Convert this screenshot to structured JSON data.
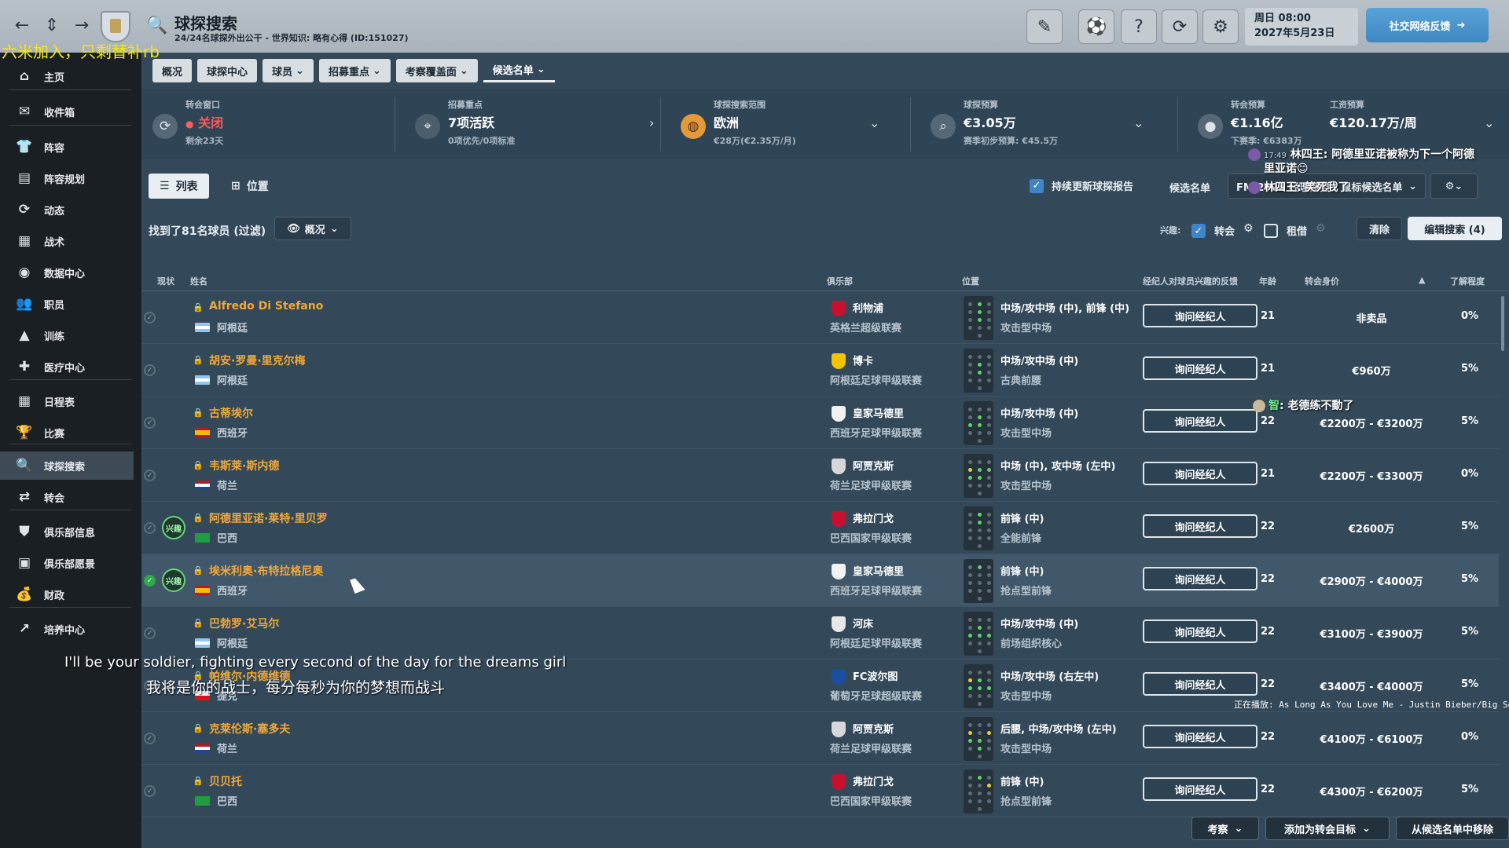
{
  "overlay": {
    "top_banner": "六米加入，只剩替补rb",
    "subtitle_en": "I'll be your soldier, fighting every second of the day for the dreams girl",
    "subtitle_cn": "我将是你的战士，每分每秒为你的梦想而战斗",
    "now_playing": "正在播放: As Long As You Love Me - Justin Bieber/Big Sean",
    "chat": [
      {
        "time": "17:49",
        "user": "林四王",
        "text": "阿德里亚诺被称为下一个阿德"
      },
      {
        "user": "",
        "text": "里亚诺😊"
      },
      {
        "time": "",
        "user": "林四王",
        "text": "笑死我了"
      },
      {
        "user": "智",
        "text": "老德练不動了"
      }
    ]
  },
  "topbar": {
    "title": "球探搜索",
    "subtitle": "24/24名球探外出公干 - 世界知识: 略有心得 (ID:151027)",
    "date_line1": "周日 08:00",
    "date_line2": "2027年5月23日",
    "feedback_label": "社交网络反馈",
    "icons": [
      "back-arrow-icon",
      "up-down-icon",
      "forward-arrow-icon",
      "search-icon",
      "pencil-icon",
      "ball-icon",
      "help-icon",
      "refresh-icon",
      "gear-icon"
    ]
  },
  "sidebar": {
    "items": [
      {
        "label": "主页",
        "icon": "home-icon",
        "glyph": "⌂"
      },
      {
        "label": "收件箱",
        "icon": "inbox-icon",
        "glyph": "✉"
      },
      {
        "label": "阵容",
        "icon": "shirt-icon",
        "glyph": "👕"
      },
      {
        "label": "阵容规划",
        "icon": "squad-planner-icon",
        "glyph": "▤"
      },
      {
        "label": "动态",
        "icon": "dynamics-icon",
        "glyph": "⟳"
      },
      {
        "label": "战术",
        "icon": "tactics-icon",
        "glyph": "▦"
      },
      {
        "label": "数据中心",
        "icon": "data-hub-icon",
        "glyph": "◉"
      },
      {
        "label": "职员",
        "icon": "staff-icon",
        "glyph": "👥"
      },
      {
        "label": "训练",
        "icon": "training-icon",
        "glyph": "▲"
      },
      {
        "label": "医疗中心",
        "icon": "medical-icon",
        "glyph": "✚"
      },
      {
        "label": "日程表",
        "icon": "calendar-icon",
        "glyph": "▦"
      },
      {
        "label": "比赛",
        "icon": "trophy-icon",
        "glyph": "🏆"
      },
      {
        "label": "球探搜索",
        "icon": "search-icon",
        "glyph": "🔍"
      },
      {
        "label": "转会",
        "icon": "transfer-icon",
        "glyph": "⇄"
      },
      {
        "label": "俱乐部信息",
        "icon": "shield-icon",
        "glyph": "⛊"
      },
      {
        "label": "俱乐部愿景",
        "icon": "vision-icon",
        "glyph": "▣"
      },
      {
        "label": "财政",
        "icon": "finance-icon",
        "glyph": "💰"
      },
      {
        "label": "培养中心",
        "icon": "development-icon",
        "glyph": "↗"
      }
    ]
  },
  "tabs": [
    "概况",
    "球探中心",
    "球员",
    "招募重点",
    "考察覆盖面",
    "候选名单"
  ],
  "info": {
    "window": {
      "label": "转会窗口",
      "value": "关闭",
      "sub": "剩余23天"
    },
    "focus": {
      "label": "招募重点",
      "value": "7项活跃",
      "sub": "0项优先/0项标准"
    },
    "range": {
      "label": "球探搜索范围",
      "value": "欧洲",
      "sub": "€28万(€2.35万/月)"
    },
    "budget": {
      "label": "球探预算",
      "value": "€3.05万",
      "sub": "赛季初步预算: €45.5万"
    },
    "transfer": {
      "label": "转会预算",
      "value": "€1.16亿",
      "sub": "下赛季: €6383万"
    },
    "wage": {
      "label": "工资预算",
      "value": "€120.17万/周"
    }
  },
  "toolbar": {
    "list_label": "列表",
    "position_label": "位置",
    "keep_updated_label": "持续更新球探报告",
    "shortlist_label": "候选名单",
    "shortlist_value": "FM 2024 经理商务 - 鼠标候选名单..."
  },
  "found": {
    "text": "找到了81名球员 (过滤)",
    "view_label": "概况",
    "interest_label": "兴趣:",
    "transfer_label": "转会",
    "loan_label": "租借",
    "clear_label": "清除",
    "edit_label": "编辑搜索 (4)"
  },
  "columns": {
    "status": "现状",
    "name": "姓名",
    "club": "俱乐部",
    "position": "位置",
    "agent": "经纪人对球员兴趣的反馈",
    "age": "年龄",
    "value": "转会身价",
    "knowledge": "了解程度"
  },
  "players": [
    {
      "name": "Alfredo Di Stefano",
      "nation": "阿根廷",
      "club": "利物浦",
      "league": "英格兰超级联赛",
      "position": "中场/攻中场 (中), 前锋 (中)",
      "role": "攻击型中场",
      "agent": "询问经纪人",
      "age": "21",
      "value": "非卖品",
      "knowledge": "0%",
      "interest": ""
    },
    {
      "name": "胡安·罗曼·里克尔梅",
      "nation": "阿根廷",
      "club": "博卡",
      "league": "阿根廷足球甲级联赛",
      "position": "中场/攻中场 (中)",
      "role": "古典前腰",
      "agent": "询问经纪人",
      "age": "21",
      "value": "€960万",
      "knowledge": "5%",
      "interest": ""
    },
    {
      "name": "古蒂埃尔",
      "nation": "西班牙",
      "club": "皇家马德里",
      "league": "西班牙足球甲级联赛",
      "position": "中场/攻中场 (中)",
      "role": "攻击型中场",
      "agent": "询问经纪人",
      "age": "22",
      "value": "€2200万 - €3200万",
      "knowledge": "5%",
      "interest": ""
    },
    {
      "name": "韦斯莱·斯内德",
      "nation": "荷兰",
      "club": "阿贾克斯",
      "league": "荷兰足球甲级联赛",
      "position": "中场 (中), 攻中场 (左中)",
      "role": "攻击型中场",
      "agent": "询问经纪人",
      "age": "21",
      "value": "€2200万 - €3300万",
      "knowledge": "0%",
      "interest": ""
    },
    {
      "name": "阿德里亚诺·莱特·里贝罗",
      "nation": "巴西",
      "club": "弗拉门戈",
      "league": "巴西国家甲级联赛",
      "position": "前锋 (中)",
      "role": "全能前锋",
      "agent": "询问经纪人",
      "age": "22",
      "value": "€2600万",
      "knowledge": "5%",
      "interest": "兴趣"
    },
    {
      "name": "埃米利奥·布特拉格尼奥",
      "nation": "西班牙",
      "club": "皇家马德里",
      "league": "西班牙足球甲级联赛",
      "position": "前锋 (中)",
      "role": "抢点型前锋",
      "agent": "询问经纪人",
      "age": "22",
      "value": "€2900万 - €4000万",
      "knowledge": "5%",
      "interest": "兴趣"
    },
    {
      "name": "巴勃罗·艾马尔",
      "nation": "阿根廷",
      "club": "河床",
      "league": "阿根廷足球甲级联赛",
      "position": "中场/攻中场 (中)",
      "role": "前场组织核心",
      "agent": "询问经纪人",
      "age": "22",
      "value": "€3100万 - €3900万",
      "knowledge": "5%",
      "interest": ""
    },
    {
      "name": "帕维尔·内德维德",
      "nation": "捷克",
      "club": "FC波尔图",
      "league": "葡萄牙足球超级联赛",
      "position": "中场/攻中场 (右左中)",
      "role": "攻击型中场",
      "agent": "询问经纪人",
      "age": "22",
      "value": "€3400万 - €4000万",
      "knowledge": "5%",
      "interest": ""
    },
    {
      "name": "克莱伦斯·塞多夫",
      "nation": "荷兰",
      "club": "阿贾克斯",
      "league": "荷兰足球甲级联赛",
      "position": "后腰, 中场/攻中场 (左中)",
      "role": "攻击型中场",
      "agent": "询问经纪人",
      "age": "22",
      "value": "€4100万 - €6100万",
      "knowledge": "0%",
      "interest": ""
    },
    {
      "name": "贝贝托",
      "nation": "巴西",
      "club": "弗拉门戈",
      "league": "巴西国家甲级联赛",
      "position": "前锋 (中)",
      "role": "抢点型前锋",
      "agent": "询问经纪人",
      "age": "22",
      "value": "€4300万 - €6200万",
      "knowledge": "5%",
      "interest": ""
    }
  ],
  "bottom": {
    "scout_label": "考察",
    "add_target_label": "添加为转会目标",
    "remove_label": "从候选名单中移除"
  },
  "colors": {
    "player_name": "#f0a83a",
    "accent_blue": "#3e86c7",
    "status_red": "#e53a3a",
    "selected_green": "#2fa94a"
  }
}
